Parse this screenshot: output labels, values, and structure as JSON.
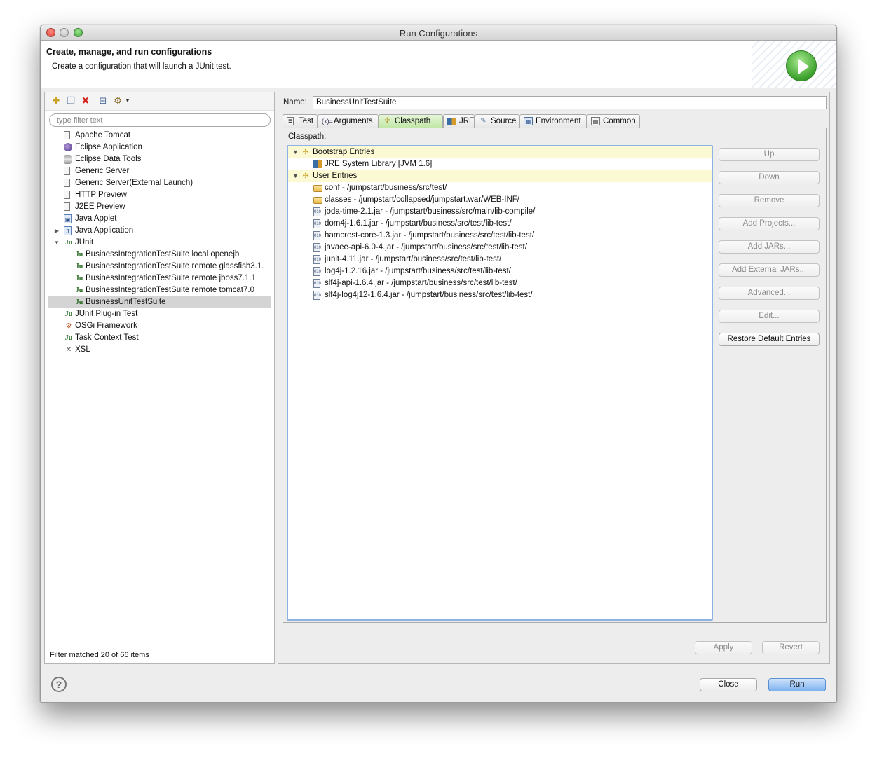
{
  "window": {
    "title": "Run Configurations"
  },
  "header": {
    "title": "Create, manage, and run configurations",
    "description": "Create a configuration that will launch a JUnit test."
  },
  "left_panel": {
    "toolbar": {
      "new_icon": "new-config-icon",
      "duplicate_icon": "duplicate-icon",
      "delete_icon": "delete-icon",
      "collapse_icon": "collapse-all-icon",
      "filter_icon": "filter-icon"
    },
    "filter_placeholder": "type filter text",
    "tree": [
      {
        "label": "Apache Tomcat",
        "icon": "doc",
        "level": 1
      },
      {
        "label": "Eclipse Application",
        "icon": "eclipse",
        "level": 1
      },
      {
        "label": "Eclipse Data Tools",
        "icon": "db",
        "level": 1
      },
      {
        "label": "Generic Server",
        "icon": "doc",
        "level": 1
      },
      {
        "label": "Generic Server(External Launch)",
        "icon": "doc",
        "level": 1
      },
      {
        "label": "HTTP Preview",
        "icon": "doc",
        "level": 1
      },
      {
        "label": "J2EE Preview",
        "icon": "doc",
        "level": 1
      },
      {
        "label": "Java Applet",
        "icon": "applet",
        "level": 1
      },
      {
        "label": "Java Application",
        "icon": "java",
        "level": 1,
        "twisty": "collapsed"
      },
      {
        "label": "JUnit",
        "icon": "ju",
        "level": 1,
        "twisty": "expanded"
      },
      {
        "label": "BusinessIntegrationTestSuite local openejb",
        "icon": "ju",
        "level": 2
      },
      {
        "label": "BusinessIntegrationTestSuite remote glassfish3.1.",
        "icon": "ju",
        "level": 2
      },
      {
        "label": "BusinessIntegrationTestSuite remote jboss7.1.1",
        "icon": "ju",
        "level": 2
      },
      {
        "label": "BusinessIntegrationTestSuite remote tomcat7.0",
        "icon": "ju",
        "level": 2
      },
      {
        "label": "BusinessUnitTestSuite",
        "icon": "ju",
        "level": 2,
        "selected": true
      },
      {
        "label": "JUnit Plug-in Test",
        "icon": "ju",
        "level": 1
      },
      {
        "label": "OSGi Framework",
        "icon": "osgi",
        "level": 1
      },
      {
        "label": "Task Context Test",
        "icon": "ju",
        "level": 1
      },
      {
        "label": "XSL",
        "icon": "xsl",
        "level": 1
      }
    ],
    "filter_status": "Filter matched 20 of 66 items"
  },
  "right_panel": {
    "name_label": "Name:",
    "name_value": "BusinessUnitTestSuite",
    "tabs": [
      {
        "label": "Test",
        "icon": "test-tab-icon"
      },
      {
        "label": "Arguments",
        "icon": "arguments-tab-icon"
      },
      {
        "label": "Classpath",
        "icon": "classpath-tab-icon",
        "active": true
      },
      {
        "label": "JRE",
        "icon": "jre-tab-icon"
      },
      {
        "label": "Source",
        "icon": "source-tab-icon"
      },
      {
        "label": "Environment",
        "icon": "environment-tab-icon"
      },
      {
        "label": "Common",
        "icon": "common-tab-icon"
      }
    ],
    "classpath_label": "Classpath:",
    "classpath_entries": [
      {
        "label": "Bootstrap Entries",
        "type": "group"
      },
      {
        "label": "JRE System Library [JVM 1.6]",
        "type": "lib"
      },
      {
        "label": "User Entries",
        "type": "group"
      },
      {
        "label": "conf - /jumpstart/business/src/test/",
        "type": "folder"
      },
      {
        "label": "classes - /jumpstart/collapsed/jumpstart.war/WEB-INF/",
        "type": "folder"
      },
      {
        "label": "joda-time-2.1.jar - /jumpstart/business/src/main/lib-compile/",
        "type": "jar"
      },
      {
        "label": "dom4j-1.6.1.jar - /jumpstart/business/src/test/lib-test/",
        "type": "jar"
      },
      {
        "label": "hamcrest-core-1.3.jar - /jumpstart/business/src/test/lib-test/",
        "type": "jar"
      },
      {
        "label": "javaee-api-6.0-4.jar - /jumpstart/business/src/test/lib-test/",
        "type": "jar"
      },
      {
        "label": "junit-4.11.jar - /jumpstart/business/src/test/lib-test/",
        "type": "jar"
      },
      {
        "label": "log4j-1.2.16.jar - /jumpstart/business/src/test/lib-test/",
        "type": "jar"
      },
      {
        "label": "slf4j-api-1.6.4.jar - /jumpstart/business/src/test/lib-test/",
        "type": "jar"
      },
      {
        "label": "slf4j-log4j12-1.6.4.jar - /jumpstart/business/src/test/lib-test/",
        "type": "jar"
      }
    ],
    "buttons": {
      "up": "Up",
      "down": "Down",
      "remove": "Remove",
      "add_projects": "Add Projects...",
      "add_jars": "Add JARs...",
      "add_external_jars": "Add External JARs...",
      "advanced": "Advanced...",
      "edit": "Edit...",
      "restore_default": "Restore Default Entries"
    },
    "apply": "Apply",
    "revert": "Revert"
  },
  "footer": {
    "help_icon": "help-icon",
    "help_glyph": "?",
    "close": "Close",
    "run": "Run"
  }
}
